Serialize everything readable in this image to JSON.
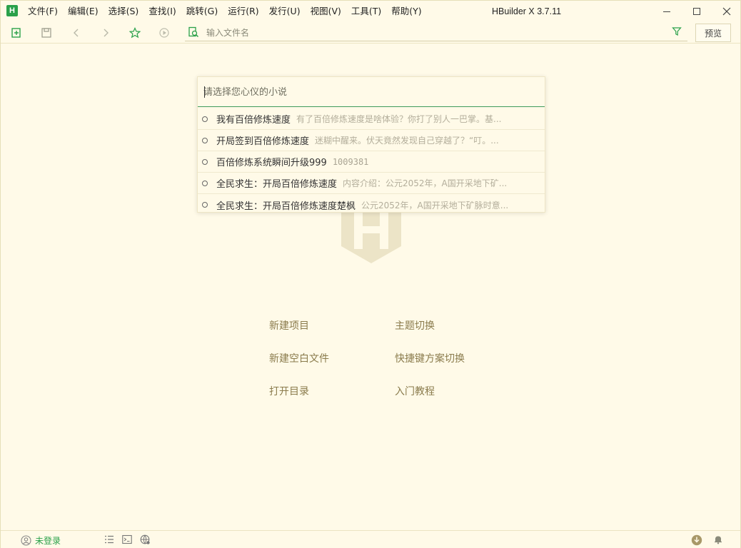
{
  "app": {
    "title": "HBuilder X 3.7.11",
    "icon_letter": "H",
    "brand_color": "#2aa14a"
  },
  "menu": [
    {
      "label": "文件(F)"
    },
    {
      "label": "编辑(E)"
    },
    {
      "label": "选择(S)"
    },
    {
      "label": "查找(I)"
    },
    {
      "label": "跳转(G)"
    },
    {
      "label": "运行(R)"
    },
    {
      "label": "发行(U)"
    },
    {
      "label": "视图(V)"
    },
    {
      "label": "工具(T)"
    },
    {
      "label": "帮助(Y)"
    }
  ],
  "toolbar": {
    "icons": [
      "new-file-icon",
      "save-icon",
      "back-icon",
      "forward-icon",
      "star-icon",
      "run-icon"
    ],
    "file_search_placeholder": "输入文件名",
    "preview_label": "预览"
  },
  "quick_open": {
    "placeholder": "请选择您心仪的小说",
    "value": "",
    "results": [
      {
        "title": "我有百倍修炼速度",
        "desc": "有了百倍修炼速度是啥体验？你打了别人一巴掌。基..."
      },
      {
        "title": "开局签到百倍修炼速度",
        "desc": "迷糊中醒来。伏天竟然发现自己穿越了？“叮。..."
      },
      {
        "title": "百倍修炼系统瞬间升级999",
        "desc": "1009381"
      },
      {
        "title": "全民求生：开局百倍修炼速度",
        "desc": "内容介绍：公元2052年，A国开采地下矿..."
      },
      {
        "title": "全民求生：开局百倍修炼速度楚枫",
        "desc": "公元2052年，A国开采地下矿脉时意..."
      }
    ]
  },
  "welcome": {
    "new_project": "新建项目",
    "theme_switch": "主题切换",
    "new_blank_file": "新建空白文件",
    "keymap_switch": "快捷键方案切换",
    "open_directory": "打开目录",
    "tutorial": "入门教程"
  },
  "statusbar": {
    "login": "未登录"
  }
}
